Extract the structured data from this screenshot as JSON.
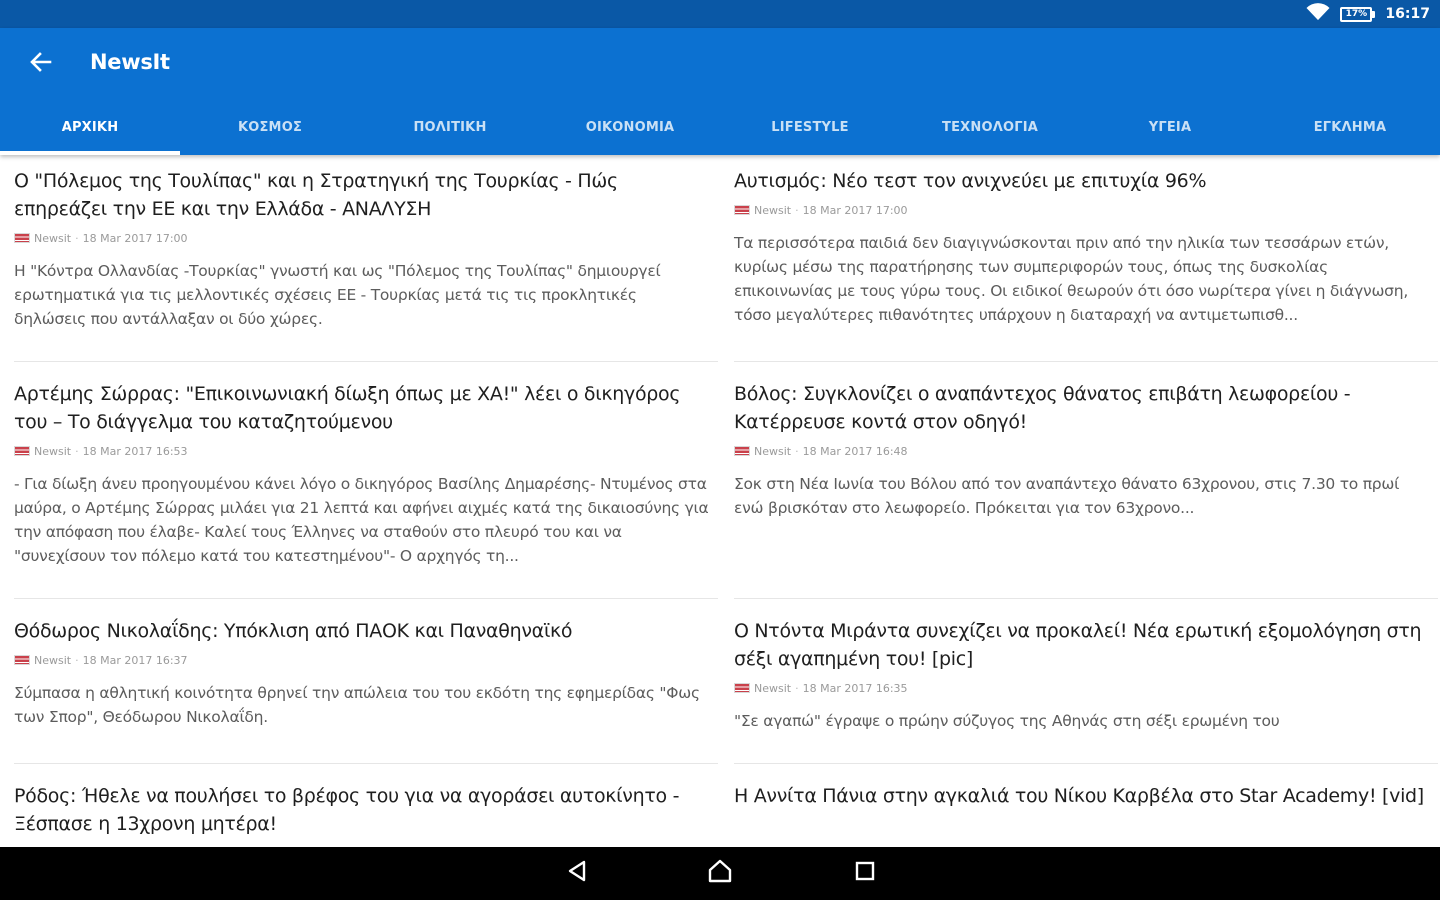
{
  "status_bar": {
    "battery": "17%",
    "time": "16:17"
  },
  "app_bar": {
    "title": "NewsIt"
  },
  "tabs": [
    {
      "label": "ΑΡΧΙΚΗ",
      "active": true
    },
    {
      "label": "ΚΟΣΜΟΣ",
      "active": false
    },
    {
      "label": "ΠΟΛΙΤΙΚΗ",
      "active": false
    },
    {
      "label": "ΟΙΚΟΝΟΜΙΑ",
      "active": false
    },
    {
      "label": "LIFESTYLE",
      "active": false
    },
    {
      "label": "ΤΕΧΝΟΛΟΓΙΑ",
      "active": false
    },
    {
      "label": "ΥΓΕΙΑ",
      "active": false
    },
    {
      "label": "ΕΓΚΛΗΜΑ",
      "active": false
    }
  ],
  "articles": {
    "left": [
      {
        "title": "Ο \"Πόλεμος της Τουλίπας\" και η Στρατηγική της Τουρκίας - Πώς επηρεάζει την ΕΕ και την Ελλάδα - ΑΝΑΛΥΣΗ",
        "source": "Newsit",
        "date": "18 Mar 2017 17:00",
        "excerpt": "Η \"Κόντρα Ολλανδίας -Τουρκίας\" γνωστή και ως \"Πόλεμος της Τουλίπας\" δημιουργεί ερωτηματικά για τις μελλοντικές σχέσεις ΕΕ - Τουρκίας μετά τις τις προκλητικές δηλώσεις που αντάλλαξαν οι δύο χώρες."
      },
      {
        "title": "Αρτέμης Σώρρας: \"Επικοινωνιακή δίωξη όπως με ΧΑ!\" λέει ο δικηγόρος του – Το διάγγελμα του καταζητούμενου",
        "source": "Newsit",
        "date": "18 Mar 2017 16:53",
        "excerpt": "- Για δίωξη άνευ προηγουμένου κάνει λόγο ο δικηγόρος Βασίλης Δημαρέσης- Ντυμένος στα μαύρα, ο Αρτέμης Σώρρας μιλάει για 21 λεπτά και αφήνει αιχμές κατά της δικαιοσύνης για την απόφαση που έλαβε- Καλεί τους Έλληνες να σταθούν στο πλευρό του και να \"συνεχίσουν τον πόλεμο κατά του κατεστημένου\"- Ο αρχηγός τη..."
      },
      {
        "title": "Θόδωρος Νικολαΐδης: Υπόκλιση από ΠΑΟΚ και Παναθηναϊκό",
        "source": "Newsit",
        "date": "18 Mar 2017 16:37",
        "excerpt": "Σύμπασα η αθλητική κοινότητα θρηνεί την απώλεια του του εκδότη της εφημερίδας \"Φως των Σπορ\", Θεόδωρου Νικολαΐδη."
      },
      {
        "title": "Ρόδος: Ήθελε να πουλήσει το βρέφος του για να αγοράσει αυτοκίνητο - Ξέσπασε η 13χρονη μητέρα!",
        "source": "",
        "date": "",
        "excerpt": ""
      }
    ],
    "right": [
      {
        "title": "Αυτισμός: Νέο τεστ τον ανιχνεύει με επιτυχία 96%",
        "source": "Newsit",
        "date": "18 Mar 2017 17:00",
        "excerpt": "Τα περισσότερα παιδιά δεν διαγιγνώσκονται πριν από την ηλικία των τεσσάρων ετών, κυρίως μέσω της παρατήρησης των συμπεριφορών τους, όπως της δυσκολίας επικοινωνίας με τους γύρω τους. Οι ειδικοί θεωρούν ότι όσο νωρίτερα γίνει η διάγνωση, τόσο μεγαλύτερες πιθανότητες υπάρχουν η διαταραχή να αντιμετωπισθ..."
      },
      {
        "title": "Βόλος: Συγκλονίζει ο αναπάντεχος θάνατος επιβάτη λεωφορείου - Κατέρρευσε κοντά στον οδηγό!",
        "source": "Newsit",
        "date": "18 Mar 2017 16:48",
        "excerpt": "Σοκ στη Νέα Ιωνία του Βόλου από τον αναπάντεχο θάνατο 63χρονου, στις 7.30 το πρωί ενώ βρισκόταν στο λεωφορείο. Πρόκειται για τον 63χρονο..."
      },
      {
        "title": "Ο Ντόντα Μιράντα συνεχίζει να προκαλεί! Νέα ερωτική εξομολόγηση στη σέξι αγαπημένη του! [pic]",
        "source": "Newsit",
        "date": "18 Mar 2017 16:35",
        "excerpt": "\"Σε αγαπώ\" έγραψε ο πρώην σύζυγος της Αθηνάς στη σέξι ερωμένη του"
      },
      {
        "title": "Η Αννίτα Πάνια στην αγκαλιά του Νίκου Καρβέλα στο Star Academy! [vid]",
        "source": "",
        "date": "",
        "excerpt": ""
      }
    ]
  },
  "colors": {
    "status_bar": "#0a58a6",
    "app_bar": "#0c71d1",
    "nav_bar": "#000000"
  },
  "icons": {
    "back": "arrow-left-icon",
    "wifi": "wifi-icon",
    "battery": "battery-icon",
    "nav_back": "triangle-back-icon",
    "nav_home": "home-icon",
    "nav_recents": "square-recents-icon"
  }
}
